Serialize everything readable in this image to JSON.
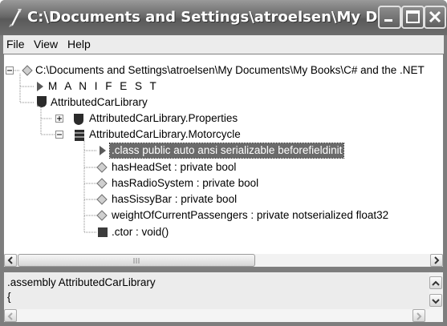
{
  "window": {
    "title": "C:\\Documents and Settings\\atroelsen\\My Document..."
  },
  "menu": {
    "items": [
      "File",
      "View",
      "Help"
    ]
  },
  "tree": {
    "nodes": [
      {
        "label": "C:\\Documents and Settings\\atroelsen\\My Documents\\My Books\\C# and the .NET",
        "icon": "assembly-diamond-icon",
        "expanded": true
      },
      {
        "label": "M A N I F E S T",
        "icon": "manifest-triangle-icon"
      },
      {
        "label": "AttributedCarLibrary",
        "icon": "namespace-shield-icon",
        "expanded": true
      },
      {
        "label": "AttributedCarLibrary.Properties",
        "icon": "namespace-shield-icon",
        "expanded": false
      },
      {
        "label": "AttributedCarLibrary.Motorcycle",
        "icon": "class-icon",
        "expanded": true
      },
      {
        "label": ".class public auto ansi serializable beforefieldinit",
        "icon": "class-info-triangle-icon",
        "selected": true
      },
      {
        "label": "hasHeadSet : private bool",
        "icon": "field-diamond-icon"
      },
      {
        "label": "hasRadioSystem : private bool",
        "icon": "field-diamond-icon"
      },
      {
        "label": "hasSissyBar : private bool",
        "icon": "field-diamond-icon"
      },
      {
        "label": "weightOfCurrentPassengers : private notserialized float32",
        "icon": "field-diamond-icon"
      },
      {
        "label": ".ctor : void()",
        "icon": "method-square-icon"
      }
    ]
  },
  "il_view": {
    "lines": [
      ".assembly AttributedCarLibrary",
      "{"
    ]
  }
}
